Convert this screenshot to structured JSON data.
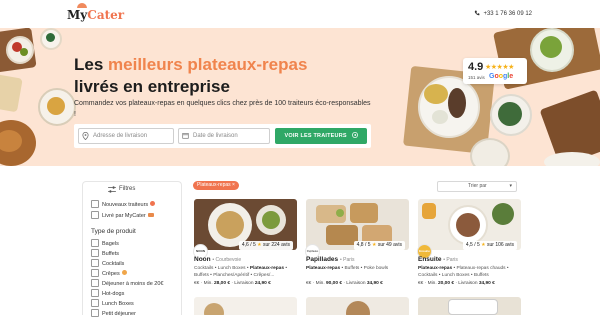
{
  "header": {
    "logo_prefix": "My",
    "logo_accent": "Cater",
    "phone": "+33 1 76 36 09 12"
  },
  "hero": {
    "title_part1": "Les ",
    "title_highlight": "meilleurs plateaux-repas",
    "title_part2": "livrés en entreprise",
    "subtitle": "Commandez vos plateaux-repas en quelques clics chez près de 100 traiteurs éco-responsables !",
    "address_placeholder": "Adresse de livraison",
    "date_placeholder": "Date de livraison",
    "cta_label": "VOIR LES TRAITEURS"
  },
  "rating": {
    "score": "4.9",
    "stars": "★★★★★",
    "count": "151 avis",
    "source": "Google"
  },
  "filters": {
    "title": "Filtres",
    "top_options": [
      "Nouveaux traiteurs",
      "Livré par MyCater"
    ],
    "section_label": "Type de produit",
    "product_types": [
      "Bagels",
      "Buffets",
      "Cocktails",
      "Crêpes",
      "Déjeuner à moins de 20€",
      "Hot-dogs",
      "Lunch Boxes",
      "Petit déjeuner"
    ]
  },
  "results": {
    "active_tag": "Plateaux-repas ×",
    "sort_label": "Trier par",
    "cards": [
      {
        "name": "Noon",
        "city": "• Courbevoie",
        "logo": "NOON",
        "rating": "4,6 / 5",
        "reviews": "sur 224 avis",
        "categories_pre": "Cocktails • Lunch Boxes • ",
        "categories_bold": "Plateaux-repas",
        "categories_post": " • Buffets • Planches/Apéritif • Crêpes/...",
        "price_symbol": "€€",
        "min_label": "Min.",
        "min_value": "28,00 €",
        "delivery_label": "Livraison",
        "delivery_value": "24,90 €"
      },
      {
        "name": "Papillades",
        "city": "• Paris",
        "logo": "Papillades",
        "rating": "4,8 / 5",
        "reviews": "sur 49 avis",
        "categories_pre": "",
        "categories_bold": "Plateaux-repas",
        "categories_post": " • Buffets • Poke bowls",
        "price_symbol": "€€",
        "min_label": "Min.",
        "min_value": "90,00 €",
        "delivery_label": "Livraison",
        "delivery_value": "34,90 €"
      },
      {
        "name": "Ensuite",
        "city": "• Paris",
        "logo": "Ensuite",
        "rating": "4,5 / 5",
        "reviews": "sur 106 avis",
        "categories_pre": "",
        "categories_bold": "Plateaux-repas",
        "categories_post": " • Plateaux-repas chauds • Cocktails • Lunch Boxes • Buffets",
        "price_symbol": "€€",
        "min_label": "Min.",
        "min_value": "20,00 €",
        "delivery_label": "Livraison",
        "delivery_value": "34,90 €"
      }
    ]
  },
  "colors": {
    "accent": "#f0744f",
    "hero_bg": "#fde4d3",
    "cta": "#2fa866",
    "star": "#f6b21b"
  }
}
